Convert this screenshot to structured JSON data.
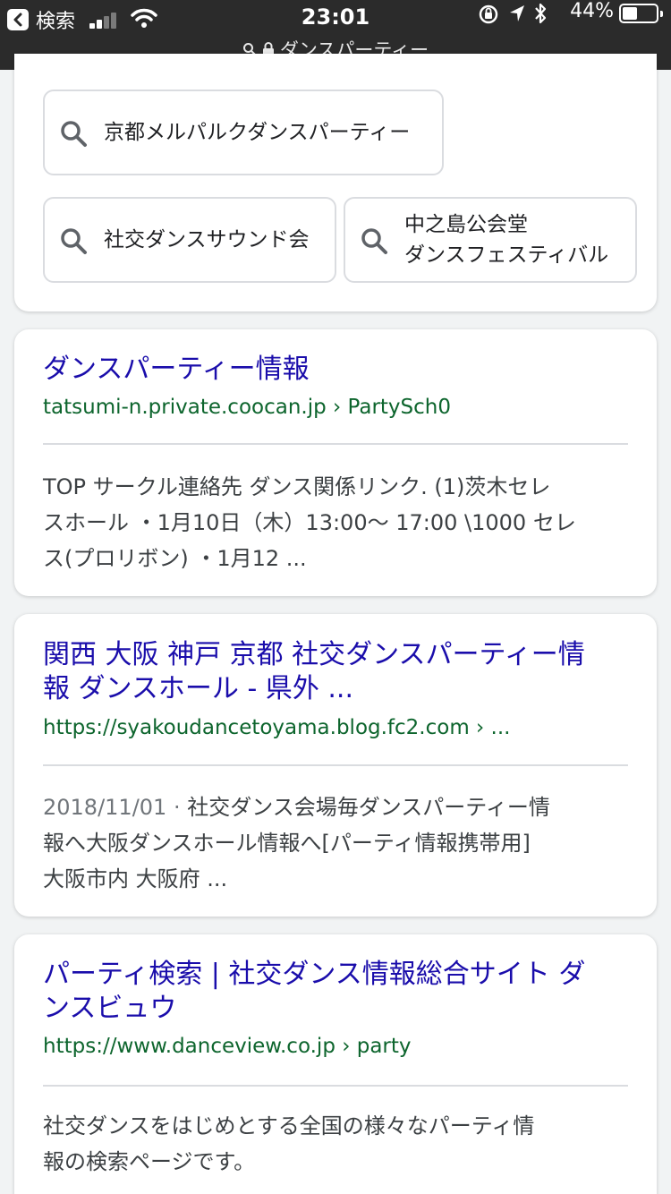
{
  "status_bar": {
    "back_label": "検索",
    "time": "23:01",
    "battery": "44%",
    "battery_level": 0.44
  },
  "url_bar": {
    "text": "ダンスパーティー"
  },
  "related_searches": [
    "京都メルパルクダンスパーティー",
    "社交ダンスサウンド会",
    "中之島公会堂",
    "ダンスフェスティバル"
  ],
  "results": [
    {
      "title": "ダンスパーティー情報",
      "url": "tatsumi-n.private.coocan.jp › PartySch0",
      "snippet_lines": [
        "TOP サークル連絡先 ダンス関係リンク. (1)茨木セレ",
        "スホール ・1月10日（木）13:00～ 17:00 \\1000 セレ",
        "ス(プロリボン) ・1月12 ..."
      ]
    },
    {
      "title_lines": [
        "関西 大阪 神戸 京都 社交ダンスパーティー情",
        "報 ダンスホール - 県外 ..."
      ],
      "url": "https://syakoudancetoyama.blog.fc2.com › ...",
      "date": "2018/11/01 · ",
      "snippet_lines": [
        "社交ダンス会場毎ダンスパーティー情",
        "報へ大阪ダンスホール情報へ[パーティ情報携帯用]",
        "大阪市内 大阪府 ..."
      ]
    },
    {
      "title_lines": [
        "パーティ検索 | 社交ダンス情報総合サイト ダ",
        "ンスビュウ"
      ],
      "url": "https://www.danceview.co.jp › party",
      "snippet_lines": [
        "社交ダンスをはじめとする全国の様々なパーティ情",
        "報の検索ページです。"
      ]
    }
  ]
}
